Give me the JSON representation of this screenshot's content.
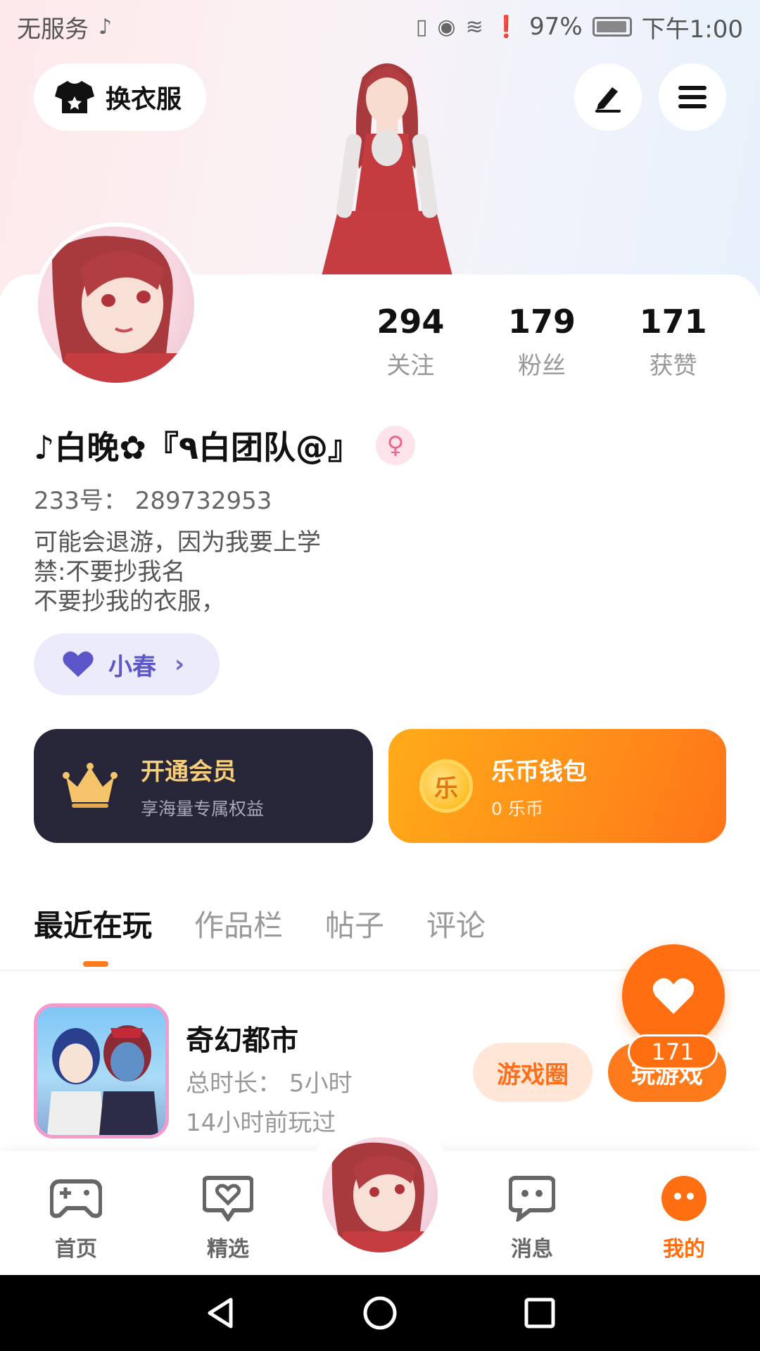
{
  "status_bar": {
    "carrier": "无服务",
    "battery_pct": "97%",
    "time": "下午1:00"
  },
  "header": {
    "outfit_label": "换衣服"
  },
  "profile": {
    "stats": [
      {
        "num": "294",
        "label": "关注"
      },
      {
        "num": "179",
        "label": "粉丝"
      },
      {
        "num": "171",
        "label": "获赞"
      }
    ],
    "username": "♪白晚✿『٩白团队@』",
    "user_id": "233号：  289732953",
    "bio": [
      "可能会退游，因为我要上学",
      "禁:不要抄我名",
      "不要抄我的衣服，"
    ],
    "tag": "小春"
  },
  "cards": {
    "vip": {
      "title": "开通会员",
      "sub": "享海量专属权益"
    },
    "wallet": {
      "title": "乐币钱包",
      "sub": "0 乐币",
      "coin_glyph": "乐"
    }
  },
  "tabs": [
    "最近在玩",
    "作品栏",
    "帖子",
    "评论"
  ],
  "game": {
    "name": "奇幻都市",
    "duration": "总时长：  5小时",
    "last_played": "14小时前玩过",
    "circle_label": "游戏圈",
    "play_label": "玩游戏"
  },
  "like": {
    "count": "171"
  },
  "nav": {
    "items": [
      {
        "label": "首页",
        "icon": "gamepad-icon"
      },
      {
        "label": "精选",
        "icon": "heart-chat-icon"
      },
      {
        "label": "消息",
        "icon": "message-icon"
      },
      {
        "label": "我的",
        "icon": "face-icon"
      }
    ]
  },
  "colors": {
    "accent": "#ff6f12",
    "vip_bg": "#272638",
    "tag_bg": "#ebebfb"
  }
}
